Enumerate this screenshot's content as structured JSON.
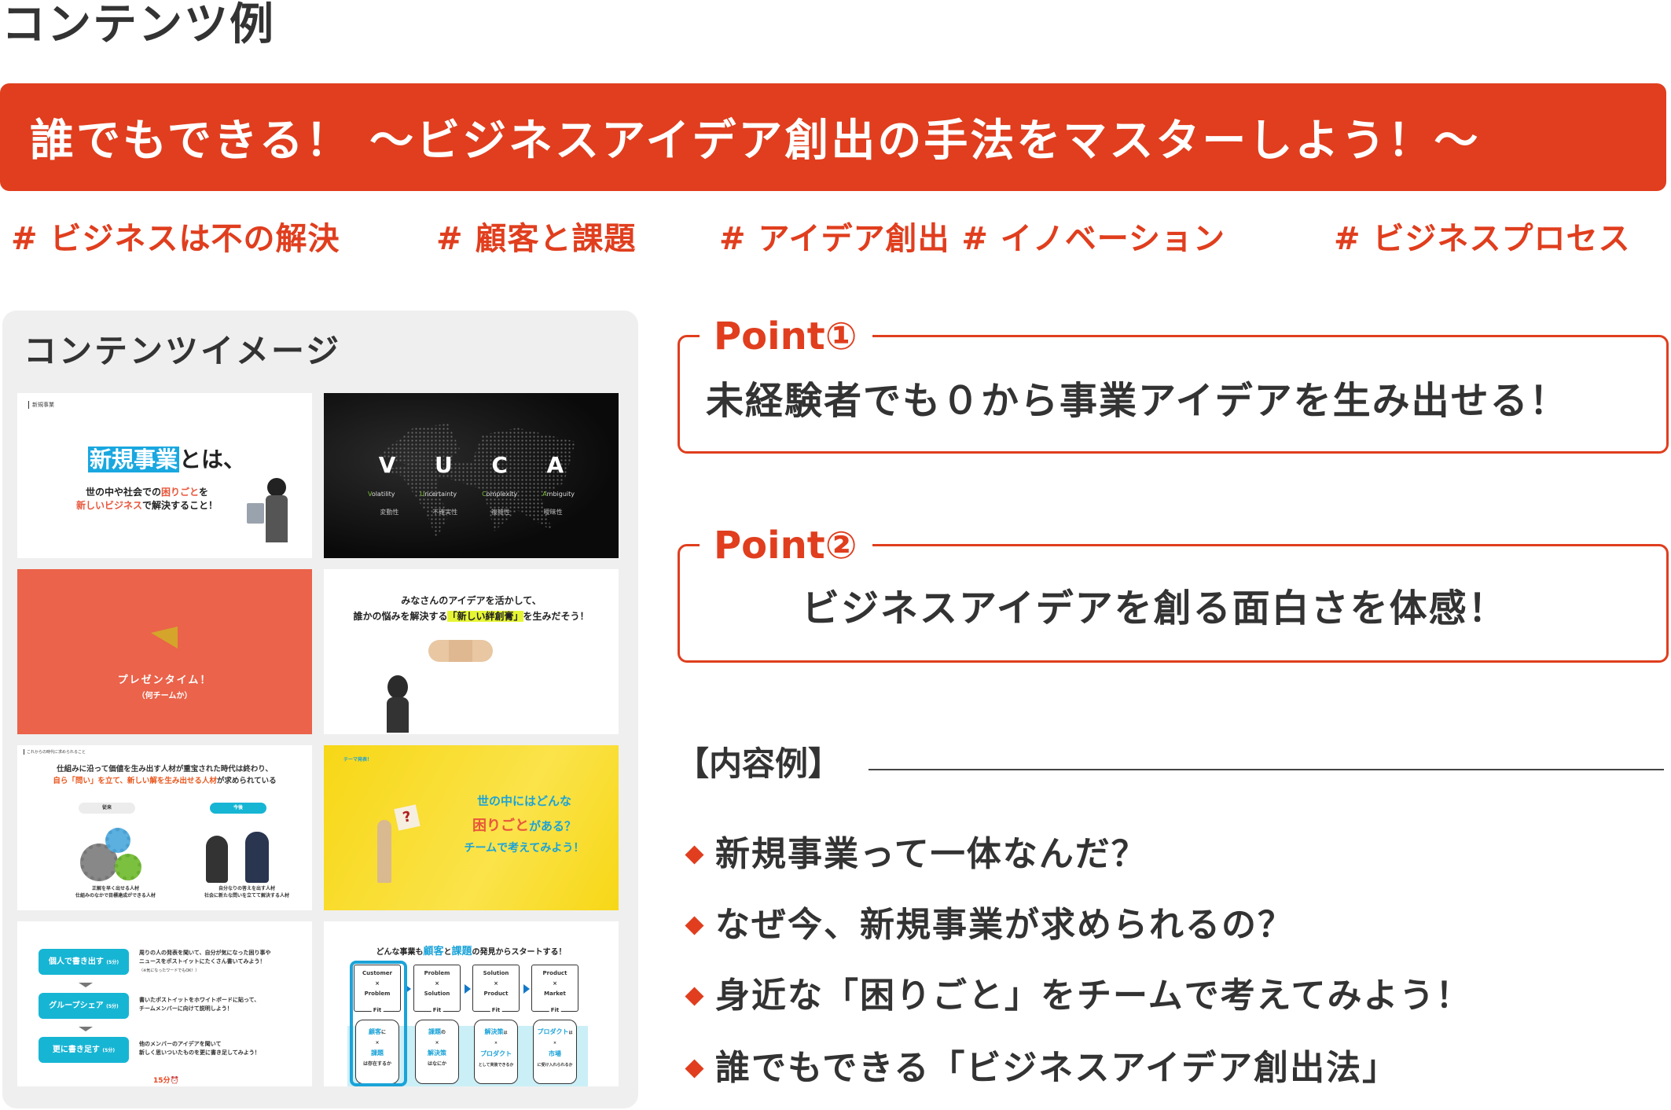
{
  "page": {
    "title": "コンテンツ例",
    "accent_color": "#E03E1E"
  },
  "banner": {
    "text": "誰でもできる！ ～ビジネスアイデア創出の手法をマスターしよう！～"
  },
  "tags": [
    "# ビジネスは不の解決",
    "# 顧客と課題",
    "# アイデア創出 # イノベーション",
    "# ビジネスプロセス"
  ],
  "panel": {
    "title": "コンテンツイメージ",
    "slides": [
      {
        "label": "新規事業",
        "title_highlight": "新規事業",
        "title_rest": "とは、",
        "line1_a": "世の中や社会での",
        "line1_red": "困りごと",
        "line1_b": "を",
        "line2_red": "新しいビジネス",
        "line2_b": "で解決すること！"
      },
      {
        "letters": [
          "V",
          "U",
          "C",
          "A"
        ],
        "words": [
          {
            "first": "V",
            "rest": "olatility"
          },
          {
            "first": "U",
            "rest": "ncertainty"
          },
          {
            "first": "C",
            "rest": "omplexity"
          },
          {
            "first": "A",
            "rest": "mbiguity"
          }
        ],
        "jp": [
          "変動性",
          "不確実性",
          "複雑性",
          "曖昧性"
        ]
      },
      {
        "title": "プレゼンタイム！",
        "subtitle": "（何チームか）"
      },
      {
        "line1": "みなさんのアイデアを活かして、",
        "line2_a": "誰かの悩みを解決する",
        "line2_hl": "「新しい絆創膏」",
        "line2_b": "を生みだそう！"
      },
      {
        "label": "これからの時代に求められること",
        "line1": "仕組みに沿って価値を生み出す人材が重宝された時代は終わり、",
        "line2_hl": "自ら「問い」を立て、新しい解を生み出せる人材",
        "line2_b": "が求められている",
        "pill_left": "従来",
        "pill_right": "今後",
        "cap_left": "正解を早く出せる人材\n仕組みのなかで目標達成ができる人材",
        "cap_right": "自分なりの答えを出す人材\n社会に新たな問いを立てて解決する人材"
      },
      {
        "label": "テーマ発表！",
        "line1": "世の中にはどんな",
        "line2_red": "困りごと",
        "line2_b": "がある？",
        "line3": "チームで考えてみよう！",
        "sign": "?"
      },
      {
        "steps": [
          {
            "label": "個人で書き出す",
            "time": "(5分)",
            "desc": "周りの人の発表を聞いて、自分が気になった困り事や\nニュースをポストイットにたくさん書いてみよう！",
            "note": "（※気になったワードでもOK！）"
          },
          {
            "label": "グループシェア",
            "time": "(5分)",
            "desc": "書いたポストイットをホワイトボードに貼って、\nチームメンバーに向けて説明しよう！",
            "note": ""
          },
          {
            "label": "更に書き足す",
            "time": "(5分)",
            "desc": "他のメンバーのアイデアを聞いて\n新しく思いついたものを更に書き足してみよう！",
            "note": ""
          }
        ],
        "total": "15分⏰"
      },
      {
        "title_a": "どんな事業も",
        "title_hl1": "顧客",
        "title_b": "と",
        "title_hl2": "課題",
        "title_c": "の発見からスタートする！",
        "fit_label": "Fit",
        "boxes": [
          {
            "top": "Customer",
            "x": "×",
            "bottom": "Problem",
            "b1": "顧客",
            "b1s": "に",
            "b2": "課題",
            "b3": "は存在するか"
          },
          {
            "top": "Problem",
            "x": "×",
            "bottom": "Solution",
            "b1": "課題",
            "b1s": "の",
            "b2": "解決策",
            "b3": "はなにか"
          },
          {
            "top": "Solution",
            "x": "×",
            "bottom": "Product",
            "b1": "解決策",
            "b1s": "は",
            "b2": "プロダクト",
            "b3": "として実装できるか"
          },
          {
            "top": "Product",
            "x": "×",
            "bottom": "Market",
            "b1": "プロダクト",
            "b1s": "は",
            "b2": "市場",
            "b3": "に受け入れられるか"
          }
        ]
      }
    ]
  },
  "points": [
    {
      "label": "Point①",
      "text": "未経験者でも０から事業アイデアを生み出せる！"
    },
    {
      "label": "Point②",
      "text": "ビジネスアイデアを創る面白さを体感！"
    }
  ],
  "content": {
    "heading": "【内容例】",
    "items": [
      "新規事業って一体なんだ？",
      "なぜ今、新規事業が求められるの？",
      "身近な「困りごと」をチームで考えてみよう！",
      "誰でもできる「ビジネスアイデア創出法」"
    ]
  }
}
